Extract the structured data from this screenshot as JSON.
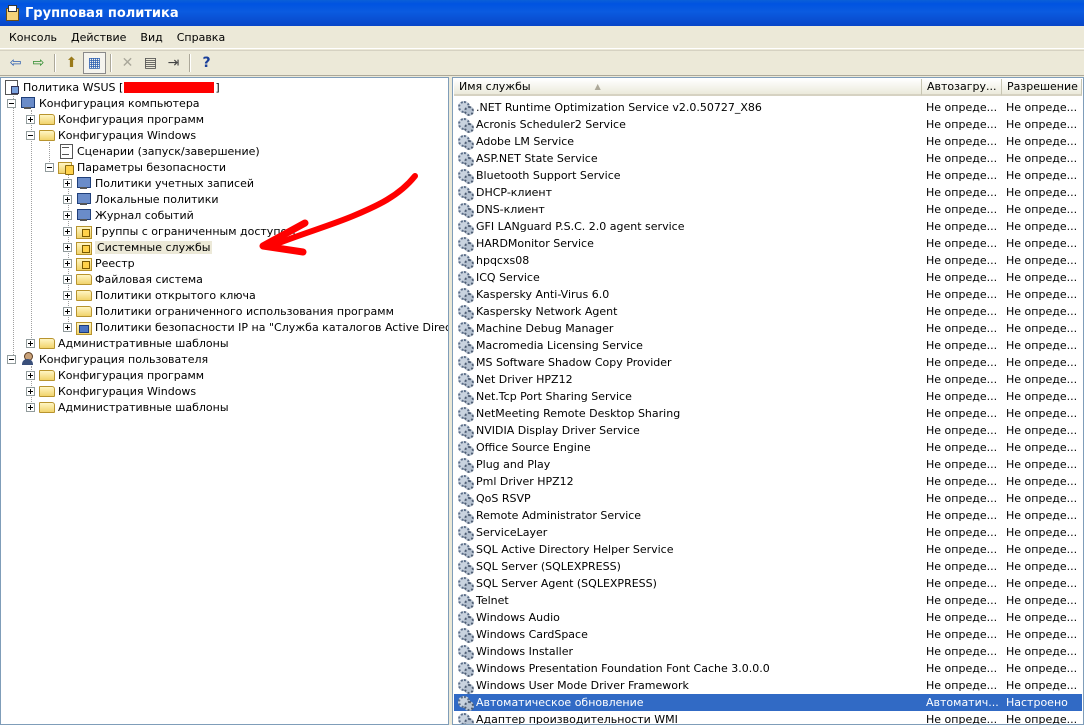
{
  "window": {
    "title": "Групповая политика"
  },
  "menu": [
    "Консоль",
    "Действие",
    "Вид",
    "Справка"
  ],
  "toolbar": {
    "buttons": [
      {
        "name": "back-arrow-icon",
        "glyph": "⇦"
      },
      {
        "name": "forward-arrow-icon",
        "glyph": "⇨"
      },
      {
        "name": "up-folder-icon",
        "glyph": "⬆"
      },
      {
        "name": "show-hide-tree-icon",
        "glyph": "▦"
      },
      {
        "name": "delete-icon",
        "glyph": "✕"
      },
      {
        "name": "properties-icon",
        "glyph": "▤"
      },
      {
        "name": "export-list-icon",
        "glyph": "⇥"
      },
      {
        "name": "help-icon",
        "glyph": "?"
      }
    ]
  },
  "tree": {
    "root_prefix": "Политика WSUS [",
    "root_suffix": "]",
    "nodes": [
      {
        "label": "Конфигурация компьютера"
      },
      {
        "label": "Конфигурация программ"
      },
      {
        "label": "Конфигурация Windows"
      },
      {
        "label": "Сценарии (запуск/завершение)"
      },
      {
        "label": "Параметры безопасности"
      },
      {
        "label": "Политики учетных записей"
      },
      {
        "label": "Локальные политики"
      },
      {
        "label": "Журнал событий"
      },
      {
        "label": "Группы с ограниченным доступом"
      },
      {
        "label": "Системные службы"
      },
      {
        "label": "Реестр"
      },
      {
        "label": "Файловая система"
      },
      {
        "label": "Политики открытого ключа"
      },
      {
        "label": "Политики ограниченного использования программ"
      },
      {
        "label": "Политики безопасности IP на \"Служба каталогов Active Directory\""
      },
      {
        "label": "Административные шаблоны"
      },
      {
        "label": "Конфигурация пользователя"
      },
      {
        "label": "Конфигурация программ"
      },
      {
        "label": "Конфигурация Windows"
      },
      {
        "label": "Административные шаблоны"
      }
    ]
  },
  "list": {
    "columns": [
      "Имя службы",
      "Автозагру...",
      "Разрешение"
    ],
    "rows": [
      {
        "name": ".NET Runtime Optimization Service v2.0.50727_X86",
        "startup": "Не опреде...",
        "permission": "Не опреде..."
      },
      {
        "name": "Acronis Scheduler2 Service",
        "startup": "Не опреде...",
        "permission": "Не опреде..."
      },
      {
        "name": "Adobe LM Service",
        "startup": "Не опреде...",
        "permission": "Не опреде..."
      },
      {
        "name": "ASP.NET State Service",
        "startup": "Не опреде...",
        "permission": "Не опреде..."
      },
      {
        "name": "Bluetooth Support Service",
        "startup": "Не опреде...",
        "permission": "Не опреде..."
      },
      {
        "name": "DHCP-клиент",
        "startup": "Не опреде...",
        "permission": "Не опреде..."
      },
      {
        "name": "DNS-клиент",
        "startup": "Не опреде...",
        "permission": "Не опреде..."
      },
      {
        "name": "GFI LANguard P.S.C. 2.0 agent service",
        "startup": "Не опреде...",
        "permission": "Не опреде..."
      },
      {
        "name": "HARDMonitor Service",
        "startup": "Не опреде...",
        "permission": "Не опреде..."
      },
      {
        "name": "hpqcxs08",
        "startup": "Не опреде...",
        "permission": "Не опреде..."
      },
      {
        "name": "ICQ Service",
        "startup": "Не опреде...",
        "permission": "Не опреде..."
      },
      {
        "name": "Kaspersky Anti-Virus 6.0",
        "startup": "Не опреде...",
        "permission": "Не опреде..."
      },
      {
        "name": "Kaspersky Network Agent",
        "startup": "Не опреде...",
        "permission": "Не опреде..."
      },
      {
        "name": "Machine Debug Manager",
        "startup": "Не опреде...",
        "permission": "Не опреде..."
      },
      {
        "name": "Macromedia Licensing Service",
        "startup": "Не опреде...",
        "permission": "Не опреде..."
      },
      {
        "name": "MS Software Shadow Copy Provider",
        "startup": "Не опреде...",
        "permission": "Не опреде..."
      },
      {
        "name": "Net Driver HPZ12",
        "startup": "Не опреде...",
        "permission": "Не опреде..."
      },
      {
        "name": "Net.Tcp Port Sharing Service",
        "startup": "Не опреде...",
        "permission": "Не опреде..."
      },
      {
        "name": "NetMeeting Remote Desktop Sharing",
        "startup": "Не опреде...",
        "permission": "Не опреде..."
      },
      {
        "name": "NVIDIA Display Driver Service",
        "startup": "Не опреде...",
        "permission": "Не опреде..."
      },
      {
        "name": "Office Source Engine",
        "startup": "Не опреде...",
        "permission": "Не опреде..."
      },
      {
        "name": "Plug and Play",
        "startup": "Не опреде...",
        "permission": "Не опреде..."
      },
      {
        "name": "Pml Driver HPZ12",
        "startup": "Не опреде...",
        "permission": "Не опреде..."
      },
      {
        "name": "QoS RSVP",
        "startup": "Не опреде...",
        "permission": "Не опреде..."
      },
      {
        "name": "Remote Administrator Service",
        "startup": "Не опреде...",
        "permission": "Не опреде..."
      },
      {
        "name": "ServiceLayer",
        "startup": "Не опреде...",
        "permission": "Не опреде..."
      },
      {
        "name": "SQL Active Directory Helper Service",
        "startup": "Не опреде...",
        "permission": "Не опреде..."
      },
      {
        "name": "SQL Server (SQLEXPRESS)",
        "startup": "Не опреде...",
        "permission": "Не опреде..."
      },
      {
        "name": "SQL Server Agent (SQLEXPRESS)",
        "startup": "Не опреде...",
        "permission": "Не опреде..."
      },
      {
        "name": "Telnet",
        "startup": "Не опреде...",
        "permission": "Не опреде..."
      },
      {
        "name": "Windows Audio",
        "startup": "Не опреде...",
        "permission": "Не опреде..."
      },
      {
        "name": "Windows CardSpace",
        "startup": "Не опреде...",
        "permission": "Не опреде..."
      },
      {
        "name": "Windows Installer",
        "startup": "Не опреде...",
        "permission": "Не опреде..."
      },
      {
        "name": "Windows Presentation Foundation Font Cache 3.0.0.0",
        "startup": "Не опреде...",
        "permission": "Не опреде..."
      },
      {
        "name": "Windows User Mode Driver Framework",
        "startup": "Не опреде...",
        "permission": "Не опреде..."
      },
      {
        "name": "Автоматическое обновление",
        "startup": "Автоматич...",
        "permission": "Настроено",
        "selected": true
      },
      {
        "name": "Адаптер производительности WMI",
        "startup": "Не опреде...",
        "permission": "Не опреде..."
      }
    ]
  },
  "colors": {
    "titlebar": "#0053e1",
    "selection": "#316ac5",
    "annotation": "#ff0000"
  }
}
